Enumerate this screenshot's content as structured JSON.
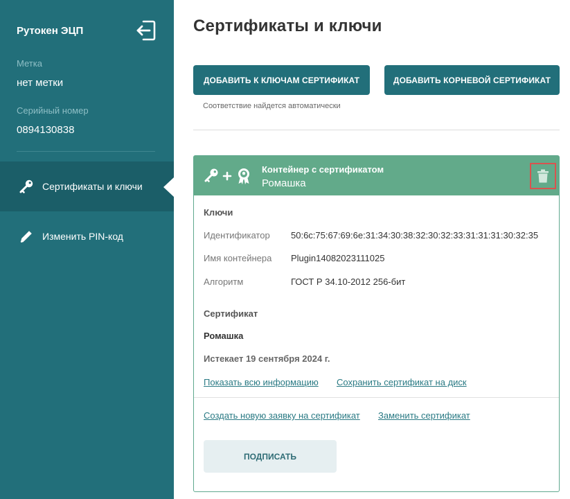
{
  "sidebar": {
    "device_name": "Рутокен ЭЦП",
    "label_caption": "Метка",
    "label_value": "нет метки",
    "serial_caption": "Серийный номер",
    "serial_value": "0894130838",
    "nav": [
      {
        "label": "Сертификаты и ключи",
        "icon": "key-icon",
        "active": true
      },
      {
        "label": "Изменить PIN-код",
        "icon": "pencil-icon",
        "active": false
      }
    ]
  },
  "main": {
    "title": "Сертификаты и ключи",
    "add_to_keys_label": "ДОБАВИТЬ К КЛЮЧАМ СЕРТИФИКАТ",
    "add_root_label": "ДОБАВИТЬ КОРНЕВОЙ СЕРТИФИКАТ",
    "hint": "Соответствие найдется автоматически"
  },
  "card": {
    "header_title": "Контейнер с сертификатом",
    "header_subtitle": "Ромашка",
    "keys_section": "Ключи",
    "keys": {
      "id_label": "Идентификатор",
      "id_value": "50:6c:75:67:69:6e:31:34:30:38:32:30:32:33:31:31:31:30:32:35",
      "container_label": "Имя контейнера",
      "container_value": "Plugin14082023111025",
      "algo_label": "Алгоритм",
      "algo_value": "ГОСТ Р 34.10-2012 256-бит"
    },
    "cert_section": "Сертификат",
    "cert_name": "Ромашка",
    "cert_expiry": "Истекает 19 сентября 2024 г.",
    "show_info_link": "Показать всю информацию",
    "save_cert_link": "Сохранить сертификат на диск",
    "new_request_link": "Создать новую заявку на сертификат",
    "replace_cert_link": "Заменить сертификат",
    "sign_label": "ПОДПИСАТЬ"
  },
  "colors": {
    "sidebar_bg": "#226f7a",
    "sidebar_active": "#1b5e68",
    "accent": "#226f7a",
    "card_header": "#62aa8a",
    "delete_highlight": "#d9534f"
  }
}
